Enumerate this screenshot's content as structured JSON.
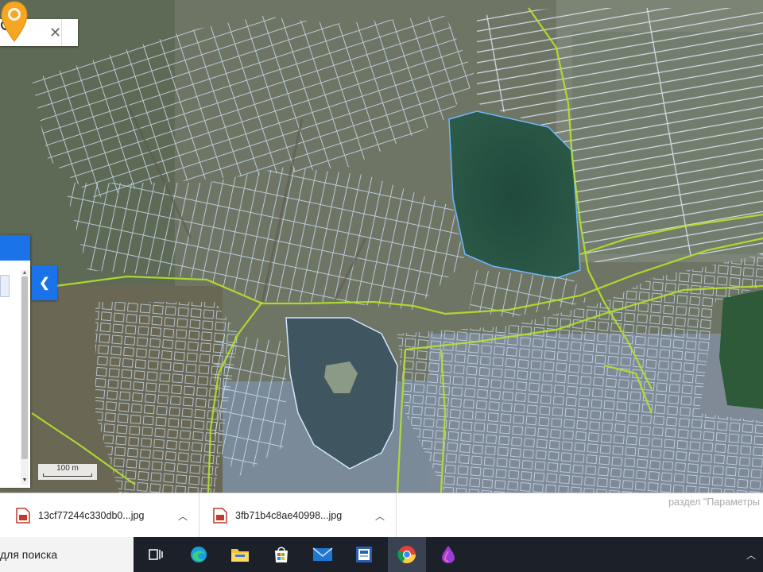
{
  "map": {
    "search": {
      "value": "",
      "placeholder": ""
    },
    "scale_label": "100 m",
    "colors": {
      "parcel_outline": "#cde6ff",
      "boundary_line": "#b6e22a",
      "panel_accent": "#1a73e8",
      "marker": "#f5a623"
    },
    "icons": {
      "clear": "close-icon",
      "search": "search-icon",
      "collapse": "chevron-left-icon",
      "marker": "location-pin-icon"
    }
  },
  "downloads": {
    "items": [
      {
        "name": "13cf77244c330db0...jpg",
        "icon": "image-file-icon"
      },
      {
        "name": "3fb71b4c8ae40998...jpg",
        "icon": "image-file-icon"
      }
    ],
    "hint": "раздел \"Параметры"
  },
  "taskbar": {
    "search_text": "для поиска",
    "apps": [
      {
        "name": "task-view-icon"
      },
      {
        "name": "edge-icon"
      },
      {
        "name": "file-explorer-icon"
      },
      {
        "name": "store-icon"
      },
      {
        "name": "mail-icon"
      },
      {
        "name": "news-app-icon"
      },
      {
        "name": "chrome-icon",
        "active": true
      },
      {
        "name": "paint-drop-icon"
      }
    ]
  }
}
